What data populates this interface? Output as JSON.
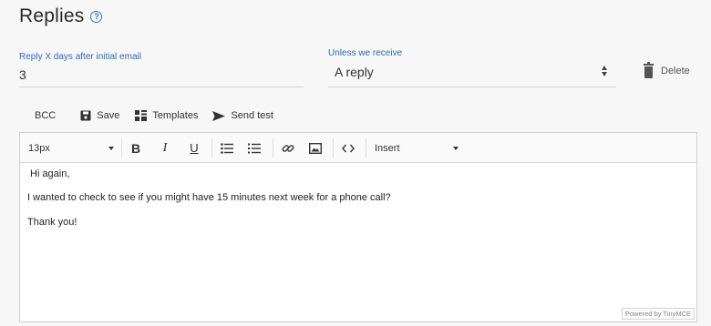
{
  "section": {
    "title": "Replies"
  },
  "reply_delay": {
    "label": "Reply X days after initial email",
    "value": "3"
  },
  "condition": {
    "label": "Unless we receive",
    "value": "A reply"
  },
  "delete": {
    "label": "Delete"
  },
  "actions": {
    "bcc": "BCC",
    "save": "Save",
    "templates": "Templates",
    "send_test": "Send test"
  },
  "editor": {
    "font_size": "13px",
    "insert_label": "Insert",
    "lines": [
      "Hi again,",
      "I wanted to check to see if you might have 15 minutes next week for a phone call?",
      "Thank you!"
    ],
    "powered_by": "Powered by TinyMCE"
  },
  "colors": {
    "accent": "#2b6cb8",
    "text": "#333333",
    "background": "#f7f7f7"
  }
}
